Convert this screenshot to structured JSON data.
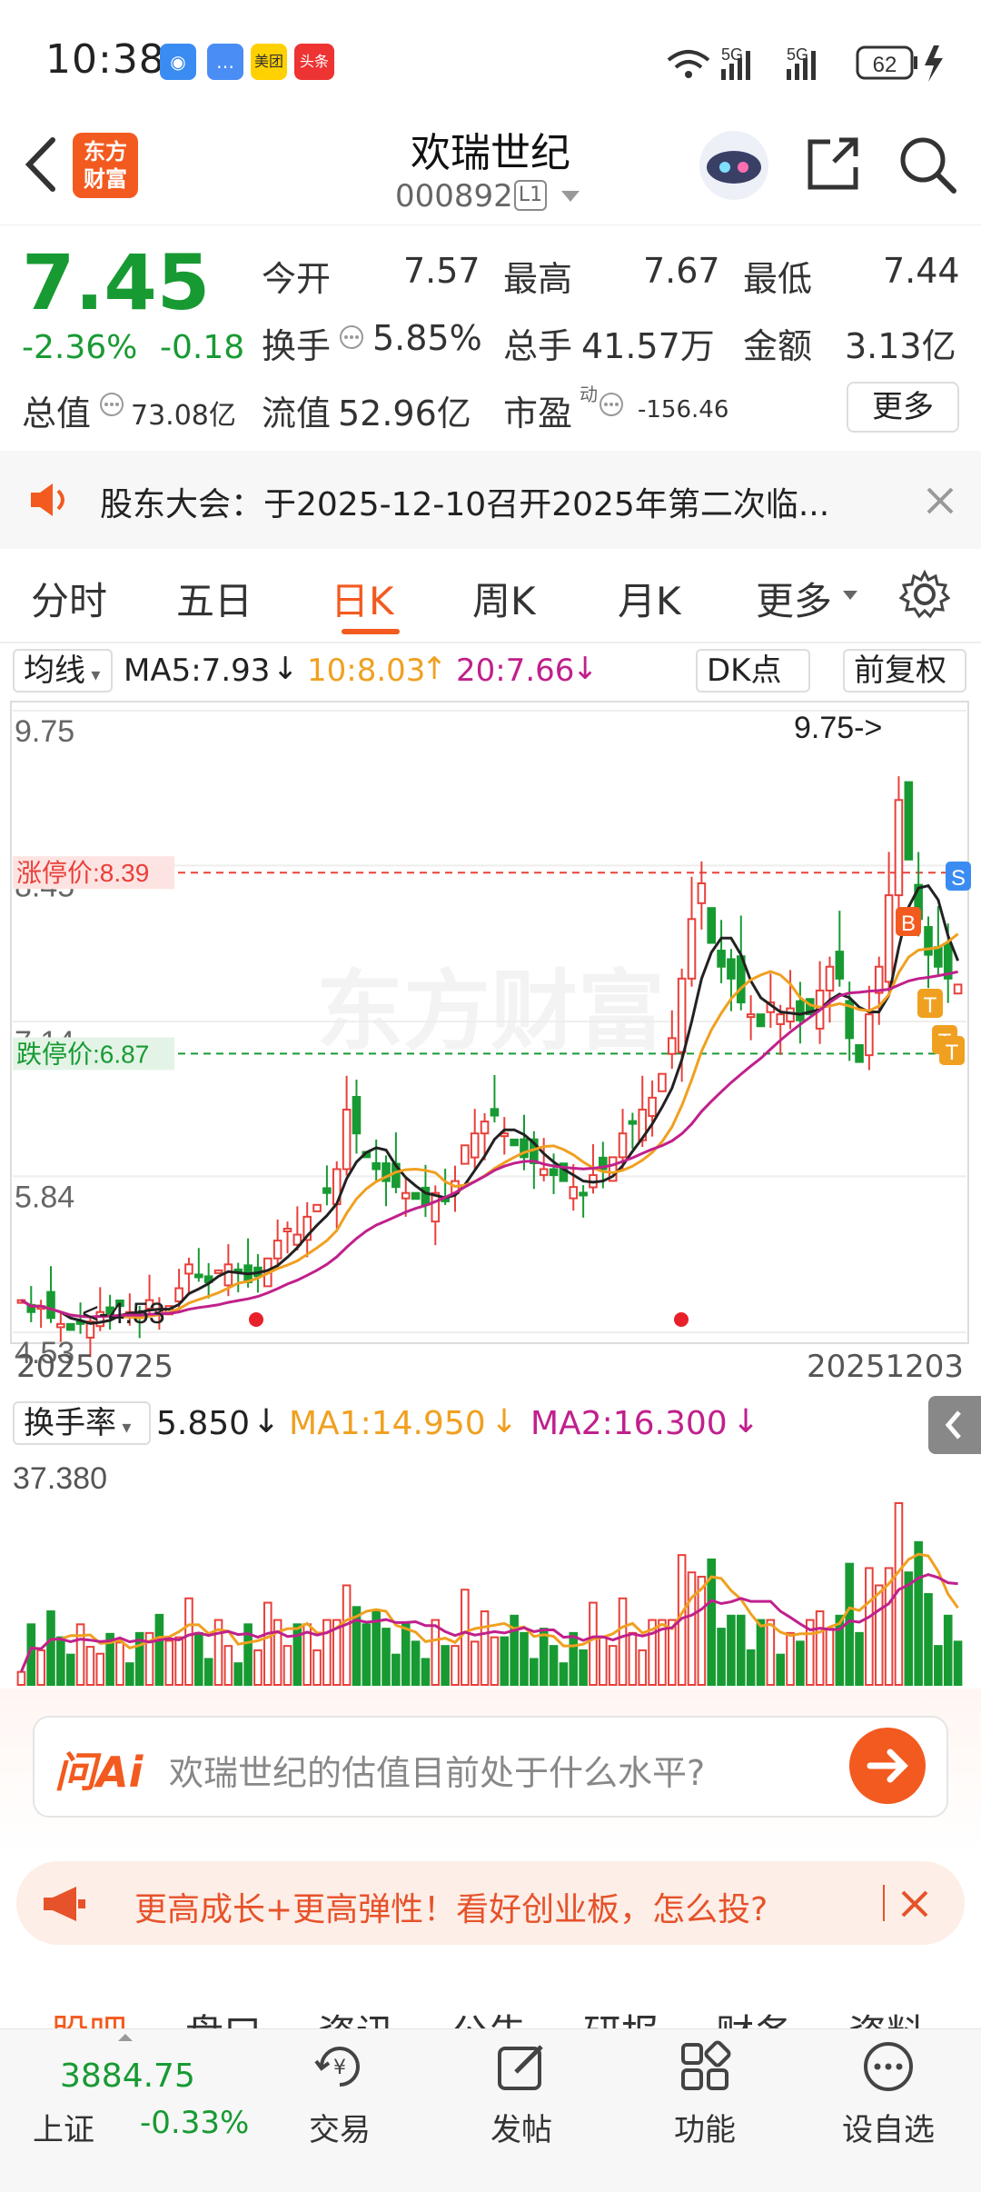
{
  "status_bar": {
    "time": "10:38",
    "battery": "62",
    "app_icons": [
      "支付宝",
      "消息",
      "美团",
      "头条"
    ],
    "network": [
      "5G",
      "5G"
    ]
  },
  "header": {
    "stock_name": "欢瑞世纪",
    "stock_code": "000892",
    "level": "L1",
    "icons": [
      "back-icon",
      "logo-东方财富",
      "robot-avatar-icon",
      "share-icon",
      "search-icon"
    ],
    "logo_text": [
      "东方",
      "财富"
    ]
  },
  "quote": {
    "price": "7.45",
    "change_pct": "-2.36%",
    "change": "-0.18",
    "open_label": "今开",
    "open": "7.57",
    "high_label": "最高",
    "high": "7.67",
    "low_label": "最低",
    "low": "7.44",
    "turnover_label": "换手",
    "turnover": "5.85%",
    "volume_label": "总手",
    "volume": "41.57万",
    "amount_label": "金额",
    "amount": "3.13亿",
    "mktcap_label": "总值",
    "mktcap": "73.08亿",
    "float_label": "流值",
    "float_cap": "52.96亿",
    "pe_label": "市盈",
    "pe_sup": "动",
    "pe": "-156.46",
    "more_label": "更多"
  },
  "notice": {
    "text": "股东大会：于2025-12-10召开2025年第二次临..."
  },
  "period_tabs": {
    "items": [
      "分时",
      "五日",
      "日K",
      "周K",
      "月K",
      "更多"
    ],
    "active": "日K"
  },
  "kline": {
    "indicator_select": "均线",
    "ma5_label": "MA5:7.93",
    "ma10_label": "10:8.03",
    "ma20_label": "20:7.66",
    "dk_label": "DK点",
    "adjust_label": "前复权",
    "y_ticks": [
      "9.75",
      "8.45",
      "7.14",
      "5.84",
      "4.53"
    ],
    "limit_up": "涨停价:8.39",
    "limit_down": "跌停价:6.87",
    "max_marker": "9.75->",
    "min_marker": "<-4.53",
    "date_start": "20250725",
    "date_end": "20251203",
    "watermark": "东方财富",
    "signal_labels": [
      "B",
      "S",
      "T",
      "T",
      "T"
    ]
  },
  "turnover_chart": {
    "select": "换手率",
    "value": "5.850",
    "ma1": "MA1:14.950",
    "ma2": "MA2:16.300",
    "y_max": "37.380"
  },
  "ask_ai": {
    "logo": "问Ai",
    "placeholder": "欢瑞世纪的估值目前处于什么水平?"
  },
  "promo": {
    "text": "更高成长+更高弹性！看好创业板，怎么投?"
  },
  "section_tabs": [
    "股吧",
    "盘口",
    "资讯",
    "公告",
    "研报",
    "财务",
    "资料"
  ],
  "section_active": "股吧",
  "bottom_bar": {
    "index_value": "3884.75",
    "index_name": "上证",
    "index_change": "-0.33%",
    "items": [
      "交易",
      "发帖",
      "功能",
      "设自选"
    ]
  },
  "colors": {
    "up": "#e8403a",
    "down": "#189a33",
    "accent": "#f35a1f",
    "ma5": "#222222",
    "ma10": "#f0a020",
    "ma20": "#c0208c"
  }
}
